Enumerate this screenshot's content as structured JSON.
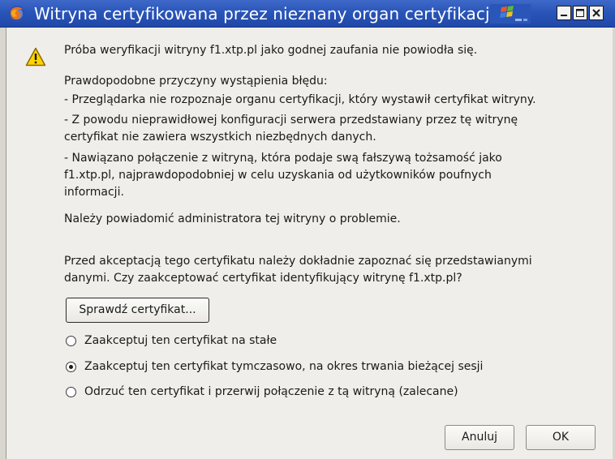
{
  "window": {
    "title": "Witryna certyfikowana przez nieznany organ certyfikacji"
  },
  "dialog": {
    "intro": "Próba weryfikacji witryny f1.xtp.pl jako godnej zaufania nie powiodła się.",
    "causes_heading": "Prawdopodobne przyczyny wystąpienia błędu:",
    "cause_1": "- Przeglądarka nie rozpoznaje organu certyfikacji, który wystawił certyfikat witryny.",
    "cause_2_line1": "- Z powodu nieprawidłowej konfiguracji serwera przedstawiany przez tę witrynę",
    "cause_2_line2": "certyfikat nie zawiera wszystkich niezbędnych danych.",
    "cause_3_line1": "- Nawiązano połączenie z witryną, która podaje swą fałszywą tożsamość jako",
    "cause_3_line2": "f1.xtp.pl, najprawdopodobniej w celu uzyskania od użytkowników poufnych",
    "cause_3_line3": "informacji.",
    "notify": "Należy powiadomić administratora tej witryny o problemie.",
    "question_line1": "Przed akceptacją tego certyfikatu należy dokładnie zapoznać się przedstawianymi",
    "question_line2": "danymi. Czy zaakceptować certyfikat identyfikujący witrynę f1.xtp.pl?",
    "examine_button": "Sprawdź certyfikat...",
    "options": [
      {
        "label": "Zaakceptuj ten certyfikat na stałe",
        "selected": false
      },
      {
        "label": "Zaakceptuj ten certyfikat tymczasowo, na okres trwania bieżącej sesji",
        "selected": true
      },
      {
        "label": "Odrzuć ten certyfikat i przerwij połączenie z tą witryną (zalecane)",
        "selected": false
      }
    ],
    "cancel_button": "Anuluj",
    "ok_button": "OK"
  },
  "icons": {
    "app": "firefox-icon",
    "warning": "warning-triangle-icon",
    "title_logo": "xp-flag-logo",
    "minimize": "minimize-icon",
    "maximize": "maximize-icon",
    "close": "close-icon"
  },
  "colors": {
    "titlebar": "#2a55b9",
    "dialog_background": "#efeeea",
    "warning_yellow": "#ffd400"
  }
}
